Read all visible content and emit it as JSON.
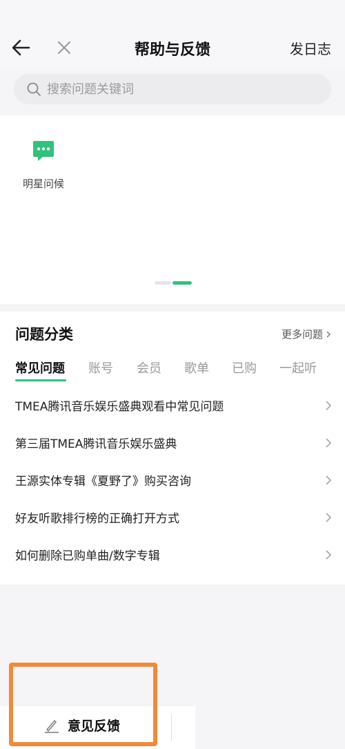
{
  "header": {
    "title": "帮助与反馈",
    "log_label": "发日志"
  },
  "search": {
    "placeholder": "搜索问题关键词"
  },
  "shortcuts": [
    {
      "label": "明星问候",
      "icon": "chat-bubble-icon"
    }
  ],
  "category": {
    "title": "问题分类",
    "more_label": "更多问题",
    "tabs": [
      "常见问题",
      "账号",
      "会员",
      "歌单",
      "已购",
      "一起听"
    ],
    "active_tab": "常见问题",
    "items": [
      "TMEA腾讯音乐娱乐盛典观看中常见问题",
      "第三届TMEA腾讯音乐娱乐盛典",
      "王源实体专辑《夏野了》购买咨询",
      "好友听歌排行榜的正确打开方式",
      "如何删除已购单曲/数字专辑"
    ]
  },
  "footer": {
    "feedback_label": "意见反馈"
  },
  "colors": {
    "accent": "#31c27c",
    "highlight": "#f08a3a"
  }
}
